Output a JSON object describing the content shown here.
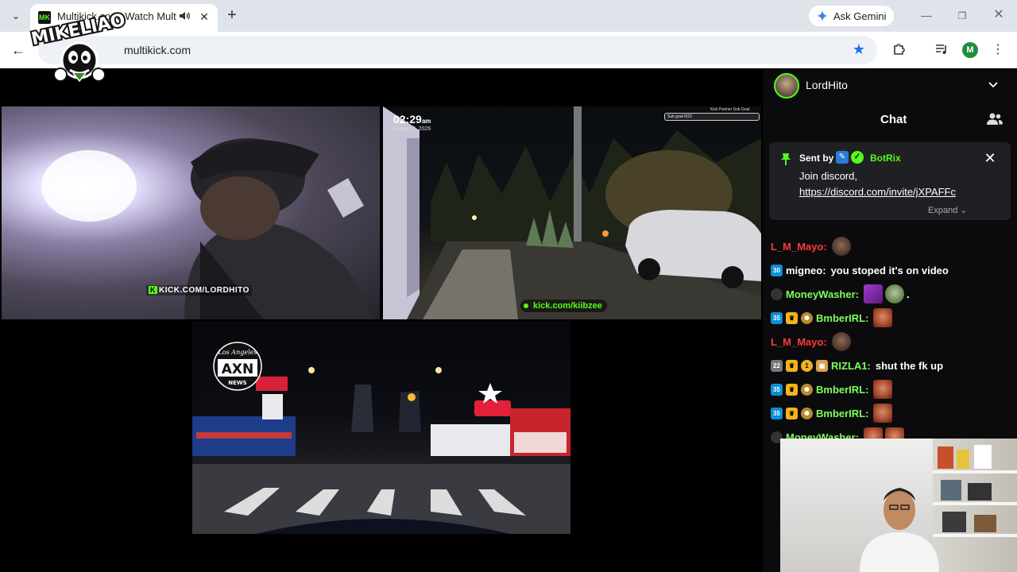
{
  "browser": {
    "tab": {
      "favicon_text": "MK",
      "title": "Multikick.com: Watch Multi",
      "close_glyph": "✕"
    },
    "new_tab_glyph": "+",
    "ask_gemini_label": "Ask Gemini",
    "url": "multikick.com",
    "profile_initial": "M",
    "window_controls": {
      "minimize": "—",
      "maximize": "❐",
      "close": "✕"
    }
  },
  "watermark": {
    "text": "MIKELIAO"
  },
  "videos": [
    {
      "id": "lordhito",
      "overlay_text": "KICK.COM/LORDHITO",
      "overlay_k": "K"
    },
    {
      "id": "kiibzee",
      "time": "02:29",
      "am": "am",
      "date": "August 7, 2026",
      "goal_label": "Kick Partner Sub Goal",
      "goal_text": "Sub goal 0/22",
      "url": "kick.com/kiibzee"
    },
    {
      "id": "axn",
      "logo_top": "Los Angeles",
      "logo_main": "AXN",
      "logo_sub": "NEWS"
    }
  ],
  "sidebar": {
    "streamer_name": "LordHito",
    "chat_title": "Chat",
    "pinned": {
      "sent_by_label": "Sent by",
      "sender": "BotRix",
      "line1": "Join discord,",
      "link": "https://discord.com/invite/jXPAFFc",
      "expand_label": "Expand"
    },
    "messages": [
      {
        "user": "L_M_Mayo:",
        "color": "#ff3b3b",
        "badges": [],
        "text": "",
        "emotes": [
          "brown"
        ]
      },
      {
        "user": "migneo:",
        "color": "#ffffff",
        "badges": [
          {
            "type": "sub",
            "text": "30"
          }
        ],
        "text": "you stoped it's on video",
        "emotes": []
      },
      {
        "user": "MoneyWasher:",
        "color": "#7dff5a",
        "badges": [
          {
            "type": "night",
            "text": ""
          }
        ],
        "text": ".",
        "emotes": [
          "purple",
          "green"
        ]
      },
      {
        "user": "BmberIRL:",
        "color": "#7dff5a",
        "badges": [
          {
            "type": "sub",
            "text": "35"
          },
          {
            "type": "crown",
            "text": "♛"
          },
          {
            "type": "wreath",
            "text": "✺"
          }
        ],
        "text": "",
        "emotes": [
          "face"
        ]
      },
      {
        "user": "L_M_Mayo:",
        "color": "#ff3b3b",
        "badges": [],
        "text": "",
        "emotes": [
          "brown"
        ]
      },
      {
        "user": "RIZLA1:",
        "color": "#7dff5a",
        "badges": [
          {
            "type": "gray",
            "text": "22"
          },
          {
            "type": "crown",
            "text": "♛"
          },
          {
            "type": "circle",
            "text": "1"
          },
          {
            "type": "gift",
            "text": "▣"
          }
        ],
        "text": "shut the fk up",
        "emotes": []
      },
      {
        "user": "BmberIRL:",
        "color": "#7dff5a",
        "badges": [
          {
            "type": "sub",
            "text": "35"
          },
          {
            "type": "crown",
            "text": "♛"
          },
          {
            "type": "wreath",
            "text": "✺"
          }
        ],
        "text": "",
        "emotes": [
          "face"
        ]
      },
      {
        "user": "BmberIRL:",
        "color": "#7dff5a",
        "badges": [
          {
            "type": "sub",
            "text": "35"
          },
          {
            "type": "crown",
            "text": "♛"
          },
          {
            "type": "wreath",
            "text": "✺"
          }
        ],
        "text": "",
        "emotes": [
          "face"
        ]
      },
      {
        "user": "MoneyWasher:",
        "color": "#7dff5a",
        "badges": [
          {
            "type": "night",
            "text": ""
          }
        ],
        "text": "",
        "emotes": [
          "face",
          "face"
        ]
      }
    ]
  },
  "colors": {
    "kick_green": "#53fc18",
    "chrome_bg": "#dfe3ea",
    "accent_blue": "#1a73e8"
  }
}
